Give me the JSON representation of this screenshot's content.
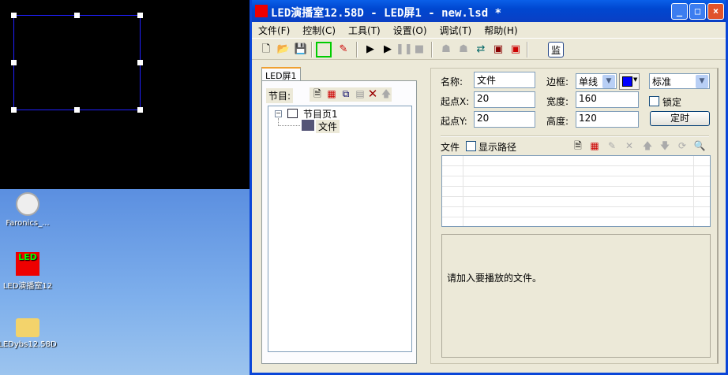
{
  "window": {
    "title": "LED演播室12.58D - LED屏1 - new.lsd *",
    "minimize": "_",
    "maximize": "□",
    "close": "×"
  },
  "menu": [
    "文件(F)",
    "控制(C)",
    "工具(T)",
    "设置(O)",
    "调试(T)",
    "帮助(H)"
  ],
  "toolbar": {
    "monitor_label": "监"
  },
  "desktop": {
    "icons": [
      {
        "label": "Faronics_..."
      },
      {
        "label": "LED演播室12"
      },
      {
        "label": "LEDybs12.58D"
      }
    ]
  },
  "left_panel": {
    "tab": "LED屏1",
    "program_label": "节目:",
    "tree": {
      "root": "节目页1",
      "child": "文件"
    }
  },
  "props": {
    "name_label": "名称:",
    "name_value": "文件",
    "x_label": "起点X:",
    "x_value": "20",
    "y_label": "起点Y:",
    "y_value": "20",
    "border_label": "边框:",
    "border_value": "单线",
    "width_label": "宽度:",
    "width_value": "160",
    "height_label": "高度:",
    "height_value": "120",
    "style_value": "标准",
    "lock_label": "锁定",
    "timer_label": "定时",
    "border_color": "#0000ff"
  },
  "files": {
    "label": "文件",
    "show_path_label": "显示路径",
    "message": "请加入要播放的文件。"
  }
}
